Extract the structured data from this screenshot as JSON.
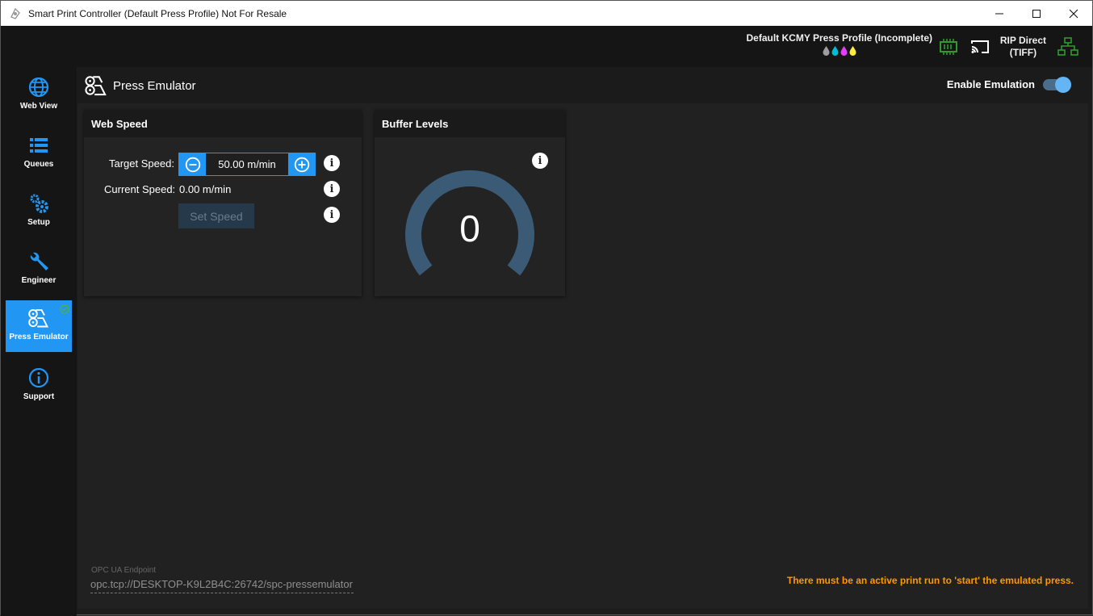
{
  "window": {
    "title": "Smart Print Controller (Default Press Profile) Not For Resale",
    "controls": [
      "minimize-icon",
      "maximize-icon",
      "close-icon"
    ]
  },
  "header": {
    "profile_name": "Default KCMY Press Profile (Incomplete)",
    "ink_drops": [
      {
        "name": "black",
        "color": "#9e9e9e"
      },
      {
        "name": "cyan",
        "color": "#00bcd4"
      },
      {
        "name": "magenta",
        "color": "#e040fb"
      },
      {
        "name": "yellow",
        "color": "#ffeb3b"
      }
    ],
    "rip_line1": "RIP Direct",
    "rip_line2": "(TIFF)",
    "status_color": "#2e9b2e"
  },
  "sidebar": {
    "items": [
      {
        "label": "Web View",
        "icon": "globe-icon"
      },
      {
        "label": "Queues",
        "icon": "list-icon"
      },
      {
        "label": "Setup",
        "icon": "gears-icon"
      },
      {
        "label": "Engineer",
        "icon": "wrench-icon"
      },
      {
        "label": "Press Emulator",
        "icon": "press-icon",
        "active": true
      },
      {
        "label": "Support",
        "icon": "info-circle-icon"
      }
    ]
  },
  "page": {
    "title": "Press Emulator",
    "toggle_label": "Enable Emulation",
    "toggle_on": true
  },
  "web_speed": {
    "title": "Web Speed",
    "target_label": "Target Speed:",
    "target_value": "50.00  m/min",
    "current_label": "Current Speed:",
    "current_value": "0.00  m/min",
    "set_button": "Set Speed"
  },
  "buffer": {
    "title": "Buffer Levels",
    "value": "0"
  },
  "footer": {
    "endpoint_label": "OPC UA Endpoint",
    "endpoint": "opc.tcp://DESKTOP-K9L2B4C:26742/spc-pressemulator",
    "warning": "There must be an active print run to 'start' the emulated press."
  },
  "colors": {
    "accent": "#2196f3",
    "warning": "#ff9800",
    "gauge": "#3b5a75"
  }
}
